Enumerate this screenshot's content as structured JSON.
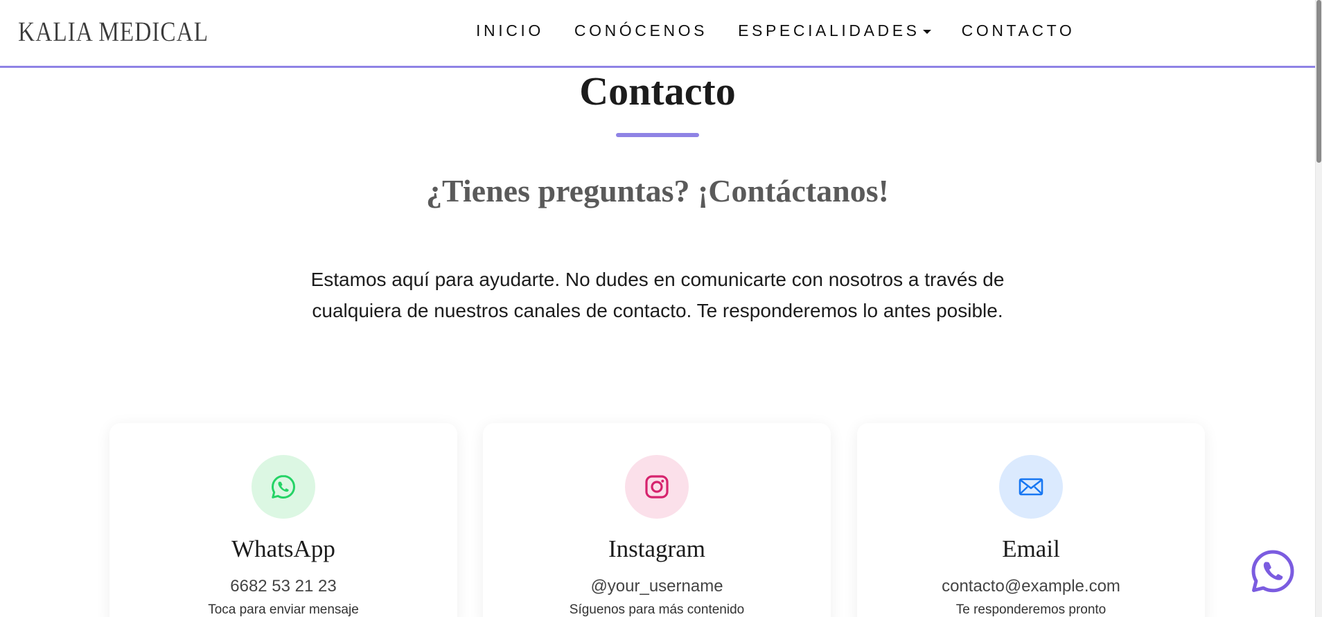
{
  "header": {
    "logo": "KALIA MEDICAL",
    "nav": [
      {
        "label": "INICIO"
      },
      {
        "label": "CONÓCENOS"
      },
      {
        "label": "ESPECIALIDADES",
        "dropdown": true
      },
      {
        "label": "CONTACTO"
      }
    ]
  },
  "section": {
    "title": "Contacto",
    "subtitle": "¿Tienes preguntas? ¡Contáctanos!",
    "intro": "Estamos aquí para ayudarte. No dudes en comunicarte con nosotros a través de cualquiera de nuestros canales de contacto. Te responderemos lo antes posible."
  },
  "cards": [
    {
      "icon": "whatsapp-icon",
      "title": "WhatsApp",
      "value": "6682 53 21 23",
      "note": "Toca para enviar mensaje"
    },
    {
      "icon": "instagram-icon",
      "title": "Instagram",
      "value": "@your_username",
      "note": "Síguenos para más contenido"
    },
    {
      "icon": "email-icon",
      "title": "Email",
      "value": "contacto@example.com",
      "note": "Te responderemos pronto"
    }
  ],
  "floating": {
    "icon": "whatsapp-float-icon"
  },
  "colors": {
    "accent": "#8f83e5",
    "whatsapp": "#25d366",
    "whatsapp_bg": "#dcf7e3",
    "instagram": "#d6246e",
    "instagram_bg": "#fbe0ea",
    "email": "#1877f2",
    "email_bg": "#dbeafe",
    "floating": "#7b5ce0"
  }
}
